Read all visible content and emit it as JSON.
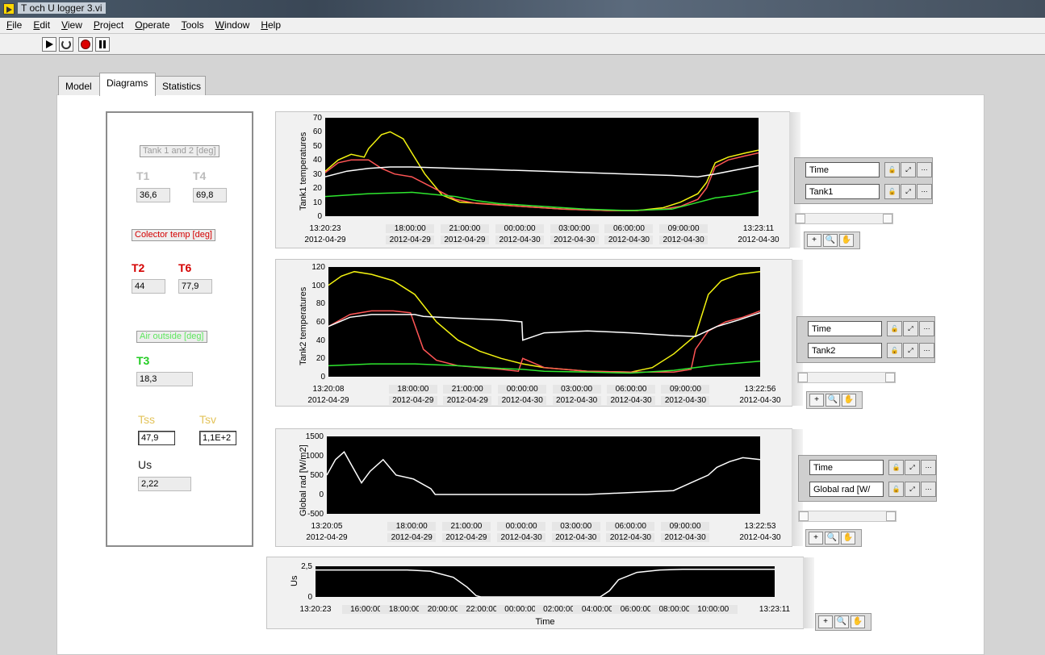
{
  "window": {
    "title": "T och U logger 3.vi"
  },
  "menu": {
    "items": [
      {
        "u": "F",
        "rest": "ile"
      },
      {
        "u": "E",
        "rest": "dit"
      },
      {
        "u": "V",
        "rest": "iew"
      },
      {
        "u": "P",
        "rest": "roject"
      },
      {
        "u": "O",
        "rest": "perate"
      },
      {
        "u": "T",
        "rest": "ools"
      },
      {
        "u": "W",
        "rest": "indow"
      },
      {
        "u": "H",
        "rest": "elp"
      }
    ]
  },
  "tabs": [
    "Model",
    "Diagrams",
    "Statistics"
  ],
  "active_tab": "Diagrams",
  "left": {
    "tank_label": "Tank 1 and 2 [deg]",
    "t1_label": "T1",
    "t1_value": "36,6",
    "t4_label": "T4",
    "t4_value": "69,8",
    "collector_label": "Colector temp [deg]",
    "t2_label": "T2",
    "t2_value": "44",
    "t6_label": "T6",
    "t6_value": "77,9",
    "air_label": "Air outside [deg]",
    "t3_label": "T3",
    "t3_value": "18,3",
    "tss_label": "Tss",
    "tss_value": "47,9",
    "tsv_label": "Tsv",
    "tsv_value": "1,1E+2",
    "us_label": "Us",
    "us_value": "2,22"
  },
  "colors": {
    "yellow": "#f3f310",
    "red": "#ff5555",
    "white": "#ffffff",
    "green": "#2ee62e",
    "gray_label": "#b9b9b9",
    "darkred": "#d40000",
    "gold": "#e3c35a"
  },
  "chart_data": [
    {
      "type": "line",
      "ylabel": "Tank1 temperatures",
      "ylim": [
        0,
        70
      ],
      "yticks": [
        "70",
        "60",
        "50",
        "40",
        "30",
        "20",
        "10",
        "0"
      ],
      "xticks": [
        {
          "t": "13:20:23",
          "d": "2012-04-29"
        },
        {
          "t": "18:00:00",
          "d": "2012-04-29"
        },
        {
          "t": "21:00:00",
          "d": "2012-04-29"
        },
        {
          "t": "00:00:00",
          "d": "2012-04-30"
        },
        {
          "t": "03:00:00",
          "d": "2012-04-30"
        },
        {
          "t": "06:00:00",
          "d": "2012-04-30"
        },
        {
          "t": "09:00:00",
          "d": "2012-04-30"
        },
        {
          "t": "13:23:11",
          "d": "2012-04-30"
        }
      ],
      "xpos": [
        0,
        0.196,
        0.322,
        0.449,
        0.575,
        0.701,
        0.827,
        1.0
      ],
      "series": [
        {
          "color": "yellow",
          "x": [
            0,
            0.03,
            0.06,
            0.09,
            0.1,
            0.13,
            0.15,
            0.18,
            0.2,
            0.23,
            0.27,
            0.31,
            0.36,
            0.45,
            0.55,
            0.65,
            0.72,
            0.78,
            0.82,
            0.86,
            0.88,
            0.9,
            0.93,
            0.97,
            1.0
          ],
          "y": [
            32,
            40,
            44,
            42,
            48,
            58,
            60,
            55,
            45,
            30,
            15,
            10,
            9,
            7,
            5,
            4,
            4,
            6,
            10,
            16,
            24,
            38,
            42,
            45,
            47
          ]
        },
        {
          "color": "red",
          "x": [
            0,
            0.03,
            0.06,
            0.1,
            0.13,
            0.16,
            0.2,
            0.25,
            0.3,
            0.35,
            0.45,
            0.55,
            0.65,
            0.72,
            0.78,
            0.82,
            0.86,
            0.88,
            0.9,
            0.93,
            0.97,
            1.0
          ],
          "y": [
            31,
            38,
            40,
            40,
            34,
            30,
            28,
            20,
            12,
            9,
            7,
            5,
            4,
            4,
            5,
            7,
            12,
            20,
            35,
            40,
            43,
            45
          ]
        },
        {
          "color": "white",
          "x": [
            0,
            0.05,
            0.1,
            0.15,
            0.2,
            0.4,
            0.6,
            0.8,
            0.86,
            0.9,
            0.95,
            1.0
          ],
          "y": [
            28,
            32,
            34,
            35,
            35,
            33,
            31,
            29,
            28,
            30,
            33,
            36
          ]
        },
        {
          "color": "green",
          "x": [
            0,
            0.1,
            0.2,
            0.3,
            0.35,
            0.4,
            0.5,
            0.6,
            0.7,
            0.8,
            0.85,
            0.9,
            0.95,
            1.0
          ],
          "y": [
            14,
            16,
            17,
            14,
            11,
            9,
            7,
            5,
            4,
            5,
            9,
            13,
            15,
            18
          ]
        }
      ]
    },
    {
      "type": "line",
      "ylabel": "Tank2 temperatures",
      "ylim": [
        0,
        120
      ],
      "yticks": [
        "120",
        "100",
        "80",
        "60",
        "40",
        "20",
        "0"
      ],
      "xticks": [
        {
          "t": "13:20:08",
          "d": "2012-04-29"
        },
        {
          "t": "18:00:00",
          "d": "2012-04-29"
        },
        {
          "t": "21:00:00",
          "d": "2012-04-29"
        },
        {
          "t": "00:00:00",
          "d": "2012-04-30"
        },
        {
          "t": "03:00:00",
          "d": "2012-04-30"
        },
        {
          "t": "06:00:00",
          "d": "2012-04-30"
        },
        {
          "t": "09:00:00",
          "d": "2012-04-30"
        },
        {
          "t": "13:22:56",
          "d": "2012-04-30"
        }
      ],
      "xpos": [
        0,
        0.196,
        0.322,
        0.449,
        0.575,
        0.701,
        0.827,
        1.0
      ],
      "series": [
        {
          "color": "yellow",
          "x": [
            0,
            0.03,
            0.06,
            0.1,
            0.15,
            0.2,
            0.25,
            0.3,
            0.35,
            0.4,
            0.45,
            0.5,
            0.6,
            0.7,
            0.75,
            0.8,
            0.85,
            0.88,
            0.91,
            0.95,
            1.0
          ],
          "y": [
            100,
            110,
            115,
            112,
            105,
            90,
            60,
            40,
            28,
            20,
            14,
            10,
            6,
            5,
            10,
            25,
            45,
            90,
            105,
            112,
            115
          ]
        },
        {
          "color": "red",
          "x": [
            0,
            0.05,
            0.1,
            0.15,
            0.19,
            0.22,
            0.25,
            0.3,
            0.4,
            0.44,
            0.45,
            0.5,
            0.6,
            0.7,
            0.8,
            0.84,
            0.85,
            0.88,
            0.92,
            0.96,
            1.0
          ],
          "y": [
            55,
            68,
            72,
            72,
            70,
            30,
            18,
            12,
            8,
            6,
            20,
            10,
            6,
            5,
            5,
            8,
            30,
            50,
            60,
            65,
            72
          ]
        },
        {
          "color": "white",
          "x": [
            0,
            0.05,
            0.1,
            0.2,
            0.22,
            0.3,
            0.4,
            0.448,
            0.45,
            0.5,
            0.6,
            0.7,
            0.8,
            0.85,
            0.9,
            0.95,
            1.0
          ],
          "y": [
            55,
            65,
            68,
            68,
            66,
            64,
            62,
            60,
            40,
            48,
            50,
            48,
            45,
            44,
            55,
            62,
            70
          ]
        },
        {
          "color": "green",
          "x": [
            0,
            0.1,
            0.2,
            0.3,
            0.4,
            0.45,
            0.5,
            0.6,
            0.7,
            0.8,
            0.9,
            1.0
          ],
          "y": [
            12,
            14,
            14,
            12,
            9,
            8,
            6,
            5,
            4,
            7,
            13,
            17
          ]
        }
      ]
    },
    {
      "type": "line",
      "ylabel": "Global rad [W/m2]",
      "ylim": [
        -500,
        1500
      ],
      "yticks": [
        "1500",
        "1000",
        "500",
        "0",
        "-500"
      ],
      "xticks": [
        {
          "t": "13:20:05",
          "d": "2012-04-29"
        },
        {
          "t": "18:00:00",
          "d": "2012-04-29"
        },
        {
          "t": "21:00:00",
          "d": "2012-04-29"
        },
        {
          "t": "00:00:00",
          "d": "2012-04-30"
        },
        {
          "t": "03:00:00",
          "d": "2012-04-30"
        },
        {
          "t": "06:00:00",
          "d": "2012-04-30"
        },
        {
          "t": "09:00:00",
          "d": "2012-04-30"
        },
        {
          "t": "13:22:53",
          "d": "2012-04-30"
        }
      ],
      "xpos": [
        0,
        0.196,
        0.322,
        0.449,
        0.575,
        0.701,
        0.827,
        1.0
      ],
      "series": [
        {
          "color": "white",
          "x": [
            0,
            0.02,
            0.04,
            0.06,
            0.08,
            0.1,
            0.13,
            0.16,
            0.2,
            0.24,
            0.25,
            0.3,
            0.4,
            0.5,
            0.6,
            0.7,
            0.8,
            0.82,
            0.85,
            0.88,
            0.9,
            0.93,
            0.96,
            1.0
          ],
          "y": [
            500,
            900,
            1100,
            700,
            300,
            600,
            900,
            500,
            400,
            150,
            0,
            0,
            0,
            0,
            0,
            50,
            100,
            200,
            350,
            500,
            700,
            850,
            950,
            900
          ]
        }
      ]
    },
    {
      "type": "line",
      "ylabel": "Us",
      "xlabel": "Time",
      "ylim": [
        0,
        2.5
      ],
      "yticks": [
        "2,5",
        "0"
      ],
      "xticks": [
        {
          "t": "13:20:23"
        },
        {
          "t": "16:00:00"
        },
        {
          "t": "18:00:00"
        },
        {
          "t": "20:00:00"
        },
        {
          "t": "22:00:00"
        },
        {
          "t": "00:00:00"
        },
        {
          "t": "02:00:00"
        },
        {
          "t": "04:00:00"
        },
        {
          "t": "06:00:00"
        },
        {
          "t": "08:00:00"
        },
        {
          "t": "10:00:00"
        },
        {
          "t": "13:23:11"
        }
      ],
      "xpos": [
        0,
        0.11,
        0.194,
        0.278,
        0.362,
        0.446,
        0.53,
        0.614,
        0.698,
        0.782,
        0.866,
        1.0
      ],
      "series": [
        {
          "color": "white",
          "x": [
            0,
            0.2,
            0.25,
            0.3,
            0.33,
            0.35,
            0.36,
            0.4,
            0.5,
            0.6,
            0.62,
            0.64,
            0.66,
            0.7,
            0.75,
            0.8,
            1.0
          ],
          "y": [
            2.2,
            2.2,
            2.1,
            1.6,
            0.8,
            0.1,
            0.0,
            0.0,
            0.0,
            0.0,
            0.0,
            0.5,
            1.4,
            2.0,
            2.2,
            2.25,
            2.25
          ]
        }
      ]
    }
  ],
  "legends": [
    {
      "x": "Time",
      "y": "Tank1"
    },
    {
      "x": "Time",
      "y": "Tank2"
    },
    {
      "x": "Time",
      "y": "Global rad [W/"
    }
  ]
}
